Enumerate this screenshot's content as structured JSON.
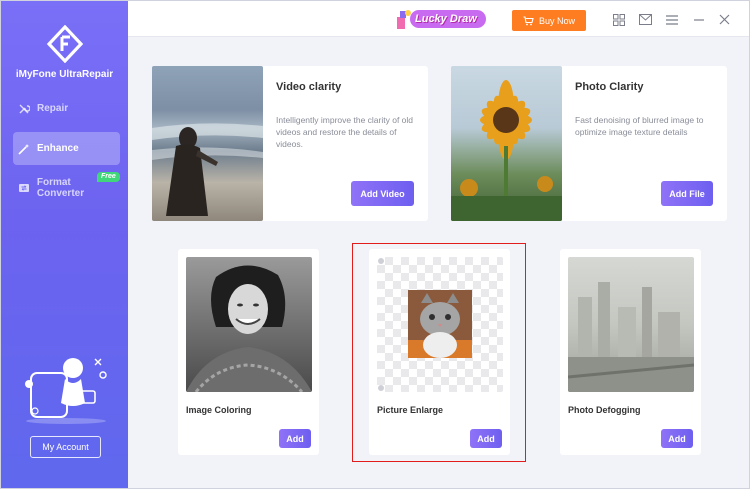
{
  "app": {
    "name": "iMyFone UltraRepair"
  },
  "sidebar": {
    "items": [
      {
        "label": "Repair",
        "icon": "wrench-icon",
        "active": false
      },
      {
        "label": "Enhance",
        "icon": "magic-wand-icon",
        "active": true
      },
      {
        "label": "Format Converter",
        "icon": "convert-icon",
        "active": false,
        "badge": "Free"
      }
    ],
    "account_label": "My Account"
  },
  "titlebar": {
    "lucky_draw": "Lucky Draw",
    "buy_now": "Buy Now",
    "icons": [
      "grid-icon",
      "mail-icon",
      "menu-icon",
      "minimize-icon",
      "close-icon"
    ]
  },
  "cards": {
    "video": {
      "title": "Video clarity",
      "description": "Intelligently improve the clarity of old videos and restore the details of videos.",
      "button": "Add Video"
    },
    "photo": {
      "title": "Photo Clarity",
      "description": "Fast denoising of blurred image to optimize image texture details",
      "button": "Add File"
    },
    "coloring": {
      "title": "Image Coloring",
      "button": "Add"
    },
    "enlarge": {
      "title": "Picture Enlarge",
      "button": "Add"
    },
    "defog": {
      "title": "Photo Defogging",
      "button": "Add"
    }
  },
  "colors": {
    "sidebar_top": "#7a6ff7",
    "sidebar_bottom": "#5f68ee",
    "accent_orange": "#ff7d21",
    "button_purple": "#7a66f3",
    "free_badge": "#3fd77a",
    "highlight_red": "#e21b1b"
  }
}
